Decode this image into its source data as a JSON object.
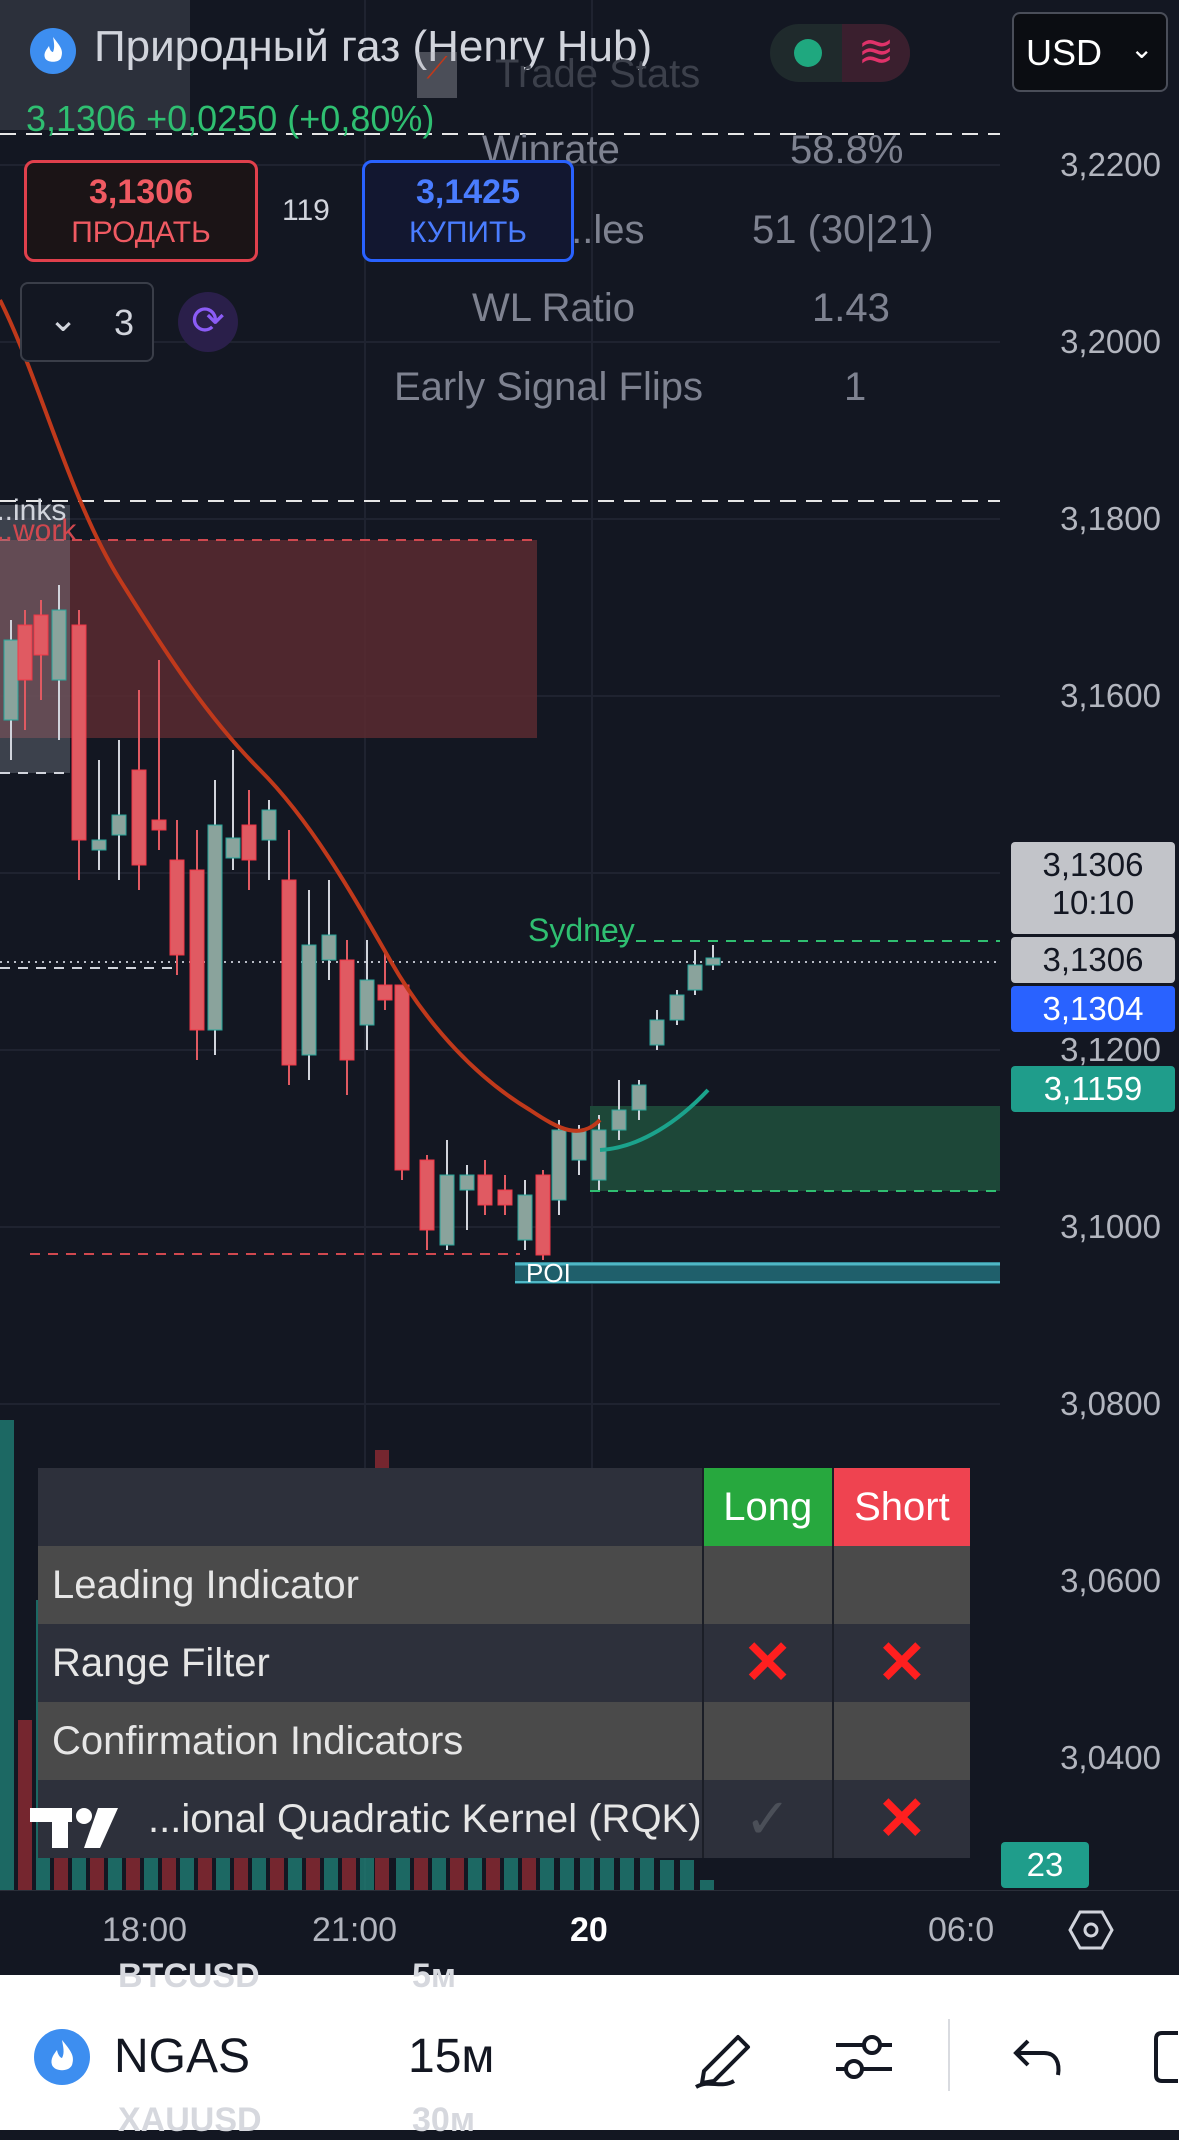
{
  "header": {
    "instrument_title": "Природный газ (Henry Hub)",
    "last_price": "3,1306",
    "change_abs": "+0,0250",
    "change_pct": "(+0,80%)",
    "currency": "USD"
  },
  "order_panel": {
    "sell_price": "3,1306",
    "sell_label": "ПРОДАТЬ",
    "spread": "119",
    "buy_price": "3,1425",
    "buy_label": "КУПИТЬ",
    "indicators_count": "3"
  },
  "trade_stats": {
    "title": "Trade Stats",
    "rows": [
      {
        "label": "Winrate",
        "value": "58.8%"
      },
      {
        "label": "...les",
        "value": "51 (30|21)"
      },
      {
        "label": "WL Ratio",
        "value": "1.43"
      },
      {
        "label": "Early Signal Flips",
        "value": "1"
      }
    ]
  },
  "chart": {
    "labels": {
      "links": "...inks",
      "work": "...work",
      "sydney": "Sydney",
      "poi": "POI"
    },
    "price_axis": [
      "3,2200",
      "3,2000",
      "3,1800",
      "3,1600",
      "3,1200",
      "3,1000",
      "3,0800",
      "3,0600",
      "3,0400"
    ],
    "price_tags": {
      "countdown_price": "3,1306",
      "countdown_time": "10:10",
      "last": "3,1306",
      "bid": "3,1304",
      "level": "3,1159",
      "volume": "23"
    },
    "time_axis": [
      "18:00",
      "21:00",
      "20",
      "06:0"
    ]
  },
  "signal_table": {
    "col_long": "Long",
    "col_short": "Short",
    "rows": [
      {
        "label": "Leading Indicator",
        "long": "",
        "short": "",
        "section": true
      },
      {
        "label": "Range Filter",
        "long": "✕",
        "short": "✕",
        "section": false
      },
      {
        "label": "Confirmation Indicators",
        "long": "",
        "short": "",
        "section": true
      },
      {
        "label": "...ional Quadratic Kernel (RQK)",
        "long": "✓",
        "short": "✕",
        "section": false
      }
    ]
  },
  "bottom_bar": {
    "symbol": "NGAS",
    "interval": "15м",
    "ghost_top_symbol": "BTCUSD",
    "ghost_top_interval": "5м",
    "ghost_bottom_symbol": "XAUUSD",
    "ghost_bottom_interval": "30м"
  },
  "colors": {
    "background": "#131722",
    "bull": "#26a69a",
    "bear": "#f23645",
    "buy_blue": "#2962ff",
    "ema": "#c0391b"
  }
}
